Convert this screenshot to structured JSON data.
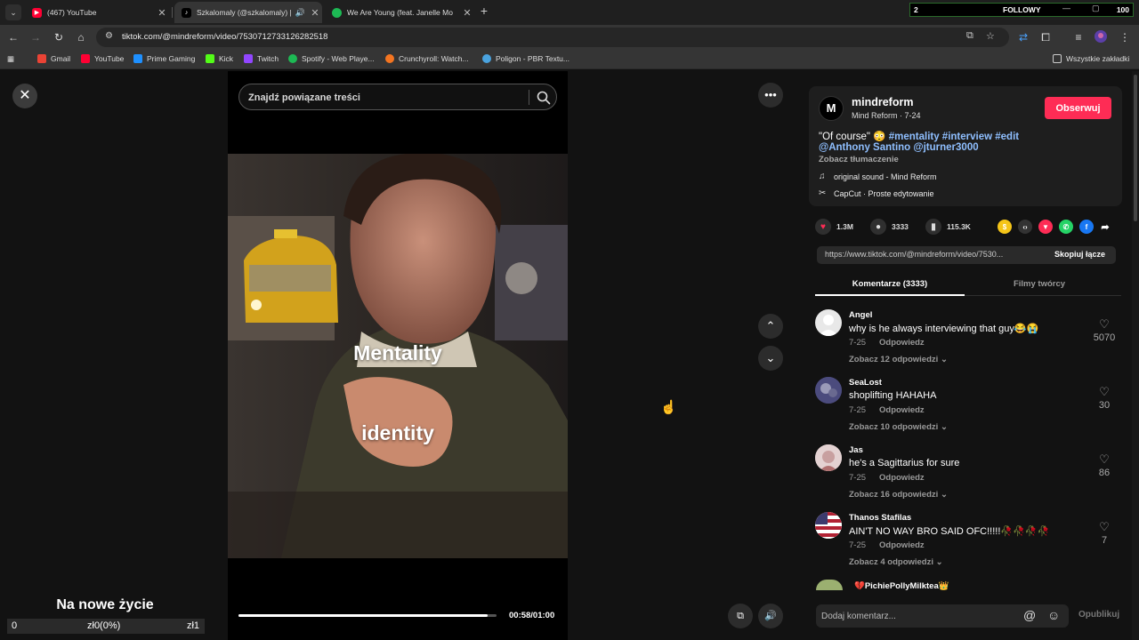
{
  "browser": {
    "tabs": [
      {
        "title": "(467) YouTube",
        "favicon": "youtube-icon",
        "color": "#ff0033"
      },
      {
        "title": "Szkalomaly (@szkalomaly) |",
        "favicon": "tiktok-icon",
        "color": "#000000"
      },
      {
        "title": "We Are Young (feat. Janelle Mo",
        "favicon": "spotify-icon",
        "color": "#1db954"
      }
    ],
    "follow_widget": {
      "left": "2",
      "center": "FOLLOWY",
      "right": "100"
    },
    "url": "tiktok.com/@mindreform/video/7530712733126282518",
    "bookmarks": [
      "Gmail",
      "YouTube",
      "Prime Gaming",
      "Kick",
      "Twitch",
      "Spotify - Web Playe...",
      "Crunchyroll: Watch...",
      "Poligon - PBR Textu..."
    ],
    "bookmark_colors": [
      "#ea4335",
      "#ff0033",
      "#1e90ff",
      "#53fc18",
      "#9146ff",
      "#1db954",
      "#f47521",
      "#4aa3df"
    ],
    "all_bookmarks": "Wszystkie zakładki"
  },
  "player": {
    "search_placeholder": "Znajdź powiązane treści",
    "caption_1": "Mentality",
    "caption_2": "identity",
    "time": "00:58/01:00",
    "progress": 0.9667
  },
  "overlay": {
    "title": "Na nowe życie",
    "left": "0",
    "center": "zł0(0%)",
    "right": "zł1"
  },
  "post": {
    "avatar_letter": "M",
    "author": "mindreform",
    "author_sub": "Mind Reform · 7-24",
    "follow_label": "Obserwuj",
    "caption_quote": "\"Of course\" 😳",
    "hashtags": "#mentality #interview #edit",
    "mentions": "@Anthony Santino @jturner3000",
    "translate": "Zobacz tłumaczenie",
    "sound": "original sound - Mind Reform",
    "capcut": "CapCut · Proste edytowanie",
    "likes": "1.3M",
    "comments_count": "3333",
    "saves": "115.3K",
    "share_link": "https://www.tiktok.com/@mindreform/video/7530...",
    "copy_label": "Skopiuj łącze",
    "tab_comments": "Komentarze (3333)",
    "tab_creator": "Filmy twórcy"
  },
  "comments": [
    {
      "name": "Angel",
      "text": "why is he always interviewing that guy😂😭",
      "date": "7-25",
      "reply": "Odpowiedz",
      "more": "Zobacz 12 odpowiedzi",
      "likes": "5070"
    },
    {
      "name": "SeaLost",
      "text": "shoplifting HAHAHA",
      "date": "7-25",
      "reply": "Odpowiedz",
      "more": "Zobacz 10 odpowiedzi",
      "likes": "30"
    },
    {
      "name": "Jas",
      "text": "he's a Sagittarius for sure",
      "date": "7-25",
      "reply": "Odpowiedz",
      "more": "Zobacz 16 odpowiedzi",
      "likes": "86"
    },
    {
      "name": "Thanos Stafilas",
      "text": "AIN'T NO WAY BRO SAID OFC!!!!!🥀🥀🥀🥀",
      "date": "7-25",
      "reply": "Odpowiedz",
      "more": "Zobacz 4 odpowiedzi",
      "likes": "7"
    }
  ],
  "partial_comment_name": "💔PichiePollyMilktea👑",
  "composer": {
    "placeholder": "Dodaj komentarz...",
    "publish": "Opublikuj"
  },
  "colors": {
    "accent": "#fe2c55",
    "link": "#8fbfff",
    "background": "#121212"
  }
}
